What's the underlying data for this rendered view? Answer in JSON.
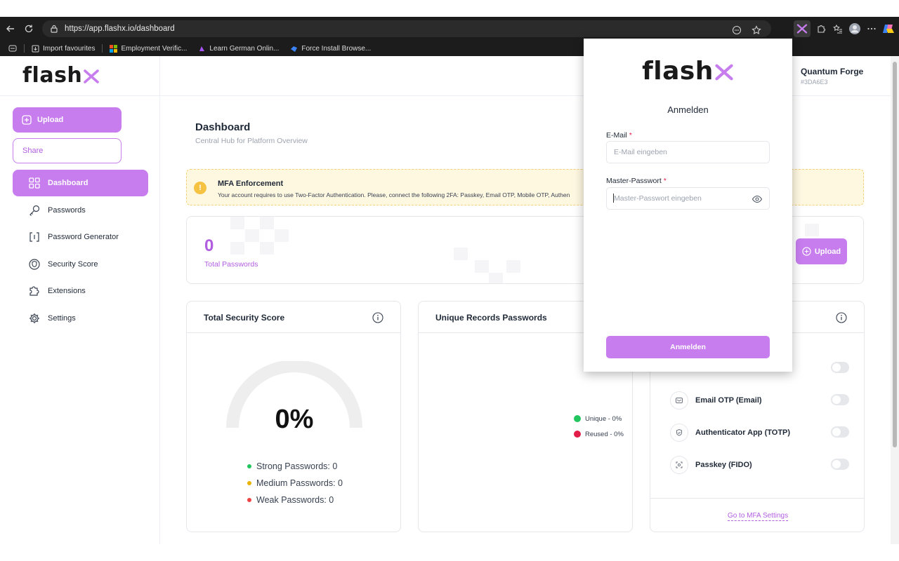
{
  "browser": {
    "url": "https://app.flashx.io/dashboard",
    "bookmarks": [
      {
        "label": "Import favourites",
        "color": "#cfcfcf"
      },
      {
        "label": "Employment Verific...",
        "color": "#f25022"
      },
      {
        "label": "Learn German Onlin...",
        "color": "#a855f7"
      },
      {
        "label": "Force Install Browse...",
        "color": "#3b82f6"
      }
    ]
  },
  "app": {
    "logo": "flash",
    "accent": "#c77dee"
  },
  "profile": {
    "name": "Quantum Forge",
    "id": "#3DA6E3"
  },
  "sidebar": {
    "upload_label": "Upload",
    "share_label": "Share",
    "items": [
      {
        "label": "Dashboard",
        "icon": "grid-icon"
      },
      {
        "label": "Passwords",
        "icon": "key-icon"
      },
      {
        "label": "Password Generator",
        "icon": "brackets-icon"
      },
      {
        "label": "Security Score",
        "icon": "shield-icon"
      },
      {
        "label": "Extensions",
        "icon": "puzzle-icon"
      },
      {
        "label": "Settings",
        "icon": "gear-icon"
      }
    ]
  },
  "main": {
    "title": "Dashboard",
    "subtitle": "Central Hub for Platform Overview",
    "mfa_banner": {
      "title": "MFA Enforcement",
      "text": "Your account requires to use Two-Factor Authentication. Please, connect the following 2FA: Passkey, Email OTP, Mobile OTP, Authen"
    },
    "stat": {
      "value": "0",
      "label": "Total Passwords",
      "upload_label": "Upload"
    },
    "security_card": {
      "title": "Total Security Score",
      "value": "0%",
      "score_fraction": 0,
      "legend": [
        {
          "label": "Strong Passwords: 0",
          "color": "#22c55e"
        },
        {
          "label": "Medium Passwords: 0",
          "color": "#eab308"
        },
        {
          "label": "Weak Passwords: 0",
          "color": "#ef4444"
        }
      ]
    },
    "unique_card": {
      "title": "Unique Records Passwords",
      "legend": [
        {
          "label": "Unique - 0%",
          "color": "#22c55e"
        },
        {
          "label": "Reused - 0%",
          "color": "#e11d48"
        }
      ]
    },
    "mfa_card": {
      "items": [
        {
          "label": "Email OTP (Email)",
          "icon": "mail-icon"
        },
        {
          "label": "Authenticator App (TOTP)",
          "icon": "shield-check-icon"
        },
        {
          "label": "Passkey (FIDO)",
          "icon": "fingerprint-icon"
        }
      ],
      "link": "Go to MFA Settings"
    }
  },
  "popup": {
    "logo": "flash",
    "heading": "Anmelden",
    "email_label": "E-Mail",
    "email_placeholder": "E-Mail eingeben",
    "password_label": "Master-Passwort",
    "password_placeholder": "Master-Passwort eingeben",
    "required_mark": "*",
    "submit_label": "Anmelden"
  }
}
